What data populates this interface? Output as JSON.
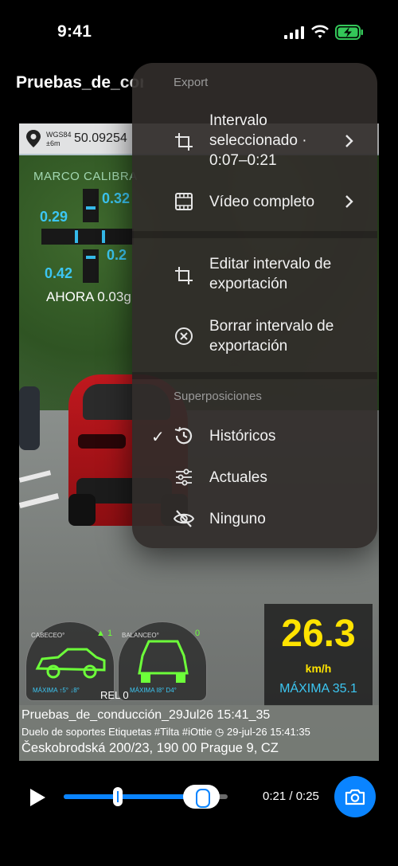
{
  "status_bar": {
    "time": "9:41"
  },
  "nav": {
    "title": "Pruebas_de_conducción"
  },
  "overlay": {
    "gps_datum": "WGS84",
    "gps_accuracy": "±6m",
    "gps_coords": "50.09254",
    "frame_label": "MARCO CALIBRA",
    "tilt_values": [
      "0.32",
      "0.29",
      "0.2",
      "0.42"
    ],
    "now_label": "AHORA 0.03g"
  },
  "hud": {
    "pitch_label": "CABECEO°",
    "pitch_value": "▲ 1",
    "pitch_max": "MÁXIMA ↑5° ↓8°",
    "roll_label": "BALANCEO°",
    "roll_value": "0",
    "roll_max": "MÁXIMA I8° D4°",
    "rel": "REL 0",
    "speed": "26.3",
    "speed_unit": "km/h",
    "speed_max": "MÁXIMA 35.1"
  },
  "info": {
    "line1": "Pruebas_de_conducción_29Jul26 15:41_35",
    "line2": "Duelo de soportes  Etiquetas  #Tilta #iOttie  ◷ 29-jul-26 15:41:35",
    "line3": "Českobrodská 200/23, 190 00 Prague 9, CZ"
  },
  "player": {
    "progress": 0.84,
    "timecode": "0:21 / 0:25"
  },
  "menu": {
    "export_header": "Export",
    "items": [
      {
        "label_lines": [
          "Intervalo",
          "seleccionado ·",
          "0:07–0:21"
        ],
        "icon": "crop-icon",
        "chevron": true
      },
      {
        "label_lines": [
          "Vídeo completo"
        ],
        "icon": "film-icon",
        "chevron": true
      },
      {
        "label_lines": [
          "Editar intervalo de",
          "exportación"
        ],
        "icon": "crop-icon",
        "chevron": false
      },
      {
        "label_lines": [
          "Borrar intervalo de",
          "exportación"
        ],
        "icon": "clear-circle-icon",
        "chevron": false
      }
    ],
    "overlays_header": "Superposiciones",
    "overlays": [
      {
        "label": "Históricos",
        "icon": "history-icon",
        "checked": true
      },
      {
        "label": "Actuales",
        "icon": "sliders-icon",
        "checked": false
      },
      {
        "label": "Ninguno",
        "icon": "eye-slash-icon",
        "checked": false
      }
    ],
    "check_mark": "✓"
  },
  "colors": {
    "accent": "#0a84ff",
    "speed": "#ffe300",
    "hud_blue": "#3cc6f2",
    "hud_green": "#6dff3a"
  }
}
